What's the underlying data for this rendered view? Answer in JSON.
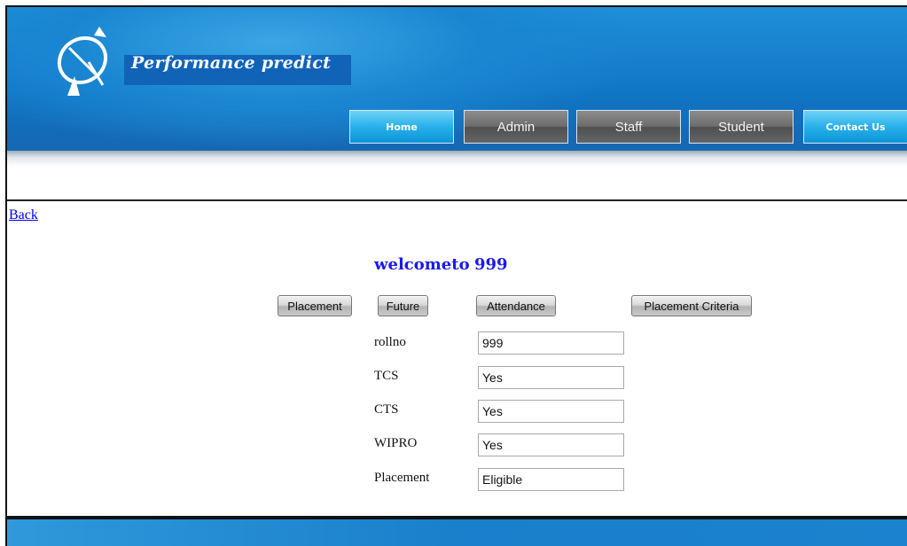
{
  "header": {
    "brand": "Performance predict",
    "nav": [
      {
        "label": "Home"
      },
      {
        "label": "Admin"
      },
      {
        "label": "Staff"
      },
      {
        "label": "Student"
      },
      {
        "label": "Contact Us"
      }
    ]
  },
  "back_link": "Back",
  "welcome": {
    "prefix": "welcometo",
    "user": "999"
  },
  "actions": [
    {
      "label": "Placement"
    },
    {
      "label": "Future"
    },
    {
      "label": "Attendance"
    },
    {
      "label": "Placement Criteria"
    }
  ],
  "fields": [
    {
      "label": "rollno",
      "value": "999"
    },
    {
      "label": "TCS",
      "value": "Yes"
    },
    {
      "label": "CTS",
      "value": "Yes"
    },
    {
      "label": "WIPRO",
      "value": "Yes"
    },
    {
      "label": "Placement",
      "value": "Eligible"
    }
  ],
  "colors": {
    "header_blue": "#1178c8",
    "link_blue": "#0000ee",
    "welcome_blue": "#1a1af0"
  },
  "icons": {
    "logo": "satellite-dish-icon"
  }
}
